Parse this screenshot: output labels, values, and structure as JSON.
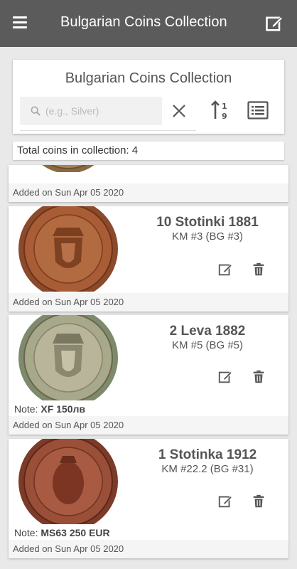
{
  "appbar": {
    "title": "Bulgarian Coins Collection"
  },
  "header": {
    "title": "Bulgarian Coins Collection",
    "search_placeholder": "(e.g., Silver)",
    "search_value": ""
  },
  "total_label": "Total coins in collection: 4",
  "coins": [
    {
      "added": "Added on Sun Apr 05 2020"
    },
    {
      "name": "10 Stotinki 1881",
      "km": "KM #3 (BG #3)",
      "added": "Added on Sun Apr 05 2020"
    },
    {
      "name": "2 Leva 1882",
      "km": "KM #5 (BG #5)",
      "note_prefix": "Note: ",
      "note_value": "XF 150лв",
      "added": "Added on Sun Apr 05 2020"
    },
    {
      "name": "1 Stotinka 1912",
      "km": "KM #22.2 (BG #31)",
      "note_prefix": "Note: ",
      "note_value": "MS63 250 EUR",
      "added": "Added on Sun Apr 05 2020"
    }
  ],
  "icons": {
    "menu": "hamburger-icon",
    "edit": "edit-icon",
    "search": "search-icon",
    "clear": "close-icon",
    "sort": "sort-numeric-icon",
    "list": "list-icon",
    "delete": "trash-icon"
  },
  "colors": {
    "appbar": "#5b5b5b",
    "background": "#e9e9e9",
    "copper": "#a0522d"
  }
}
